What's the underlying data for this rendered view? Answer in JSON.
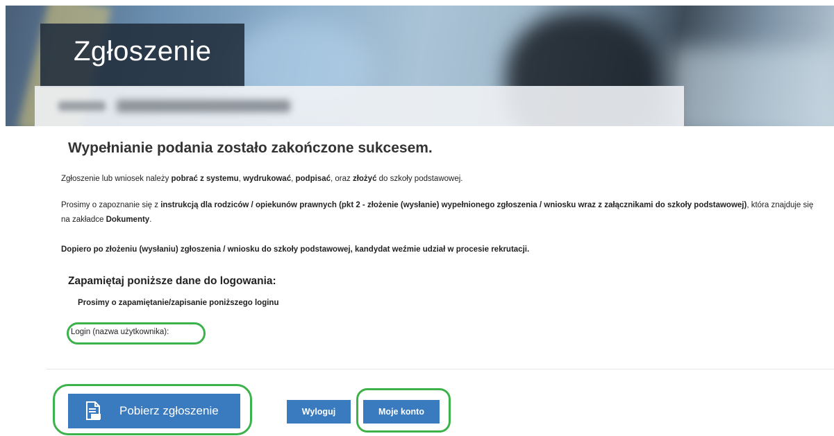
{
  "banner": {
    "title": "Zgłoszenie"
  },
  "main": {
    "heading": "Wypełnianie podania zostało zakończone sukcesem.",
    "p1": {
      "t1": "Zgłoszenie lub wniosek należy ",
      "b1": "pobrać z systemu",
      "t2": ", ",
      "b2": "wydrukować",
      "t3": ", ",
      "b3": "podpisać",
      "t4": ", oraz ",
      "b4": "złożyć",
      "t5": "  do szkoły podstawowej."
    },
    "p2": {
      "t1": "Prosimy o zapoznanie się z ",
      "b1": "instrukcją dla rodziców / opiekunów prawnych (pkt 2 - złożenie (wysłanie) wypełnionego zgłoszenia / wniosku wraz z załącznikami do szkoły podstawowej)",
      "t2": ", która znajduje się na zakładce ",
      "b2": "Dokumenty",
      "t3": "."
    },
    "p3": "Dopiero po złożeniu (wysłaniu) zgłoszenia / wniosku do szkoły podstawowej, kandydat weźmie udział w procesie rekrutacji.",
    "login_title": "Zapamiętaj poniższe dane do logowania:",
    "login_sub": "Prosimy o zapamiętanie/zapisanie poniższego loginu",
    "login_label": "Login (nazwa użytkownika):"
  },
  "buttons": {
    "pobierz": "Pobierz zgłoszenie",
    "wyloguj": "Wyloguj",
    "moje_konto": "Moje konto"
  },
  "colors": {
    "button_blue": "#3a7bbf",
    "highlight_green": "#3bb24a"
  },
  "icons": {
    "pobierz_icon": "pdf-document-icon"
  }
}
